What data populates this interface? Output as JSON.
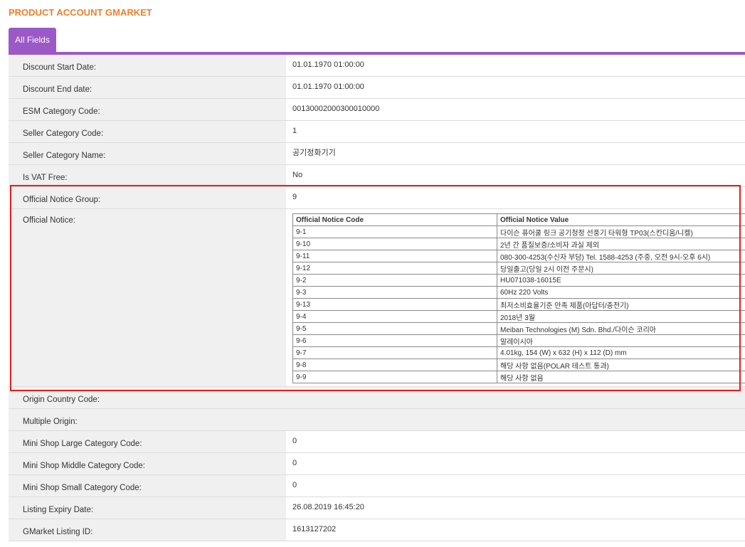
{
  "header": {
    "title": "PRODUCT ACCOUNT GMARKET"
  },
  "tabs": [
    {
      "label": "All Fields"
    }
  ],
  "fields_top": [
    {
      "label": "Discount Start Date:",
      "value": "01.01.1970 01:00:00"
    },
    {
      "label": "Discount End date:",
      "value": "01.01.1970 01:00:00"
    },
    {
      "label": "ESM Category Code:",
      "value": "00130002000300010000"
    },
    {
      "label": "Seller Category Code:",
      "value": "1"
    },
    {
      "label": "Seller Category Name:",
      "value": "공기정화기기"
    },
    {
      "label": "Is VAT Free:",
      "value": "No"
    },
    {
      "label": "Official Notice Group:",
      "value": "9"
    }
  ],
  "official_notice": {
    "label": "Official Notice:",
    "columns": [
      "Official Notice Code",
      "Official Notice Value"
    ],
    "rows": [
      [
        "9-1",
        "다이슨 퓨어쿨 링크 공기청정 선풍기 타워형 TP03(스칸디움/니켈)"
      ],
      [
        "9-10",
        "2년 간 품질보증/소비자 과실 제외"
      ],
      [
        "9-11",
        "080-300-4253(수신자 부담) Tel. 1588-4253 (주중, 오전 9시-오후 6시)"
      ],
      [
        "9-12",
        "당일출고(당일 2시 이전 주문시)"
      ],
      [
        "9-2",
        "HU071038-16015E"
      ],
      [
        "9-3",
        "60Hz 220 Volts"
      ],
      [
        "9-13",
        "최저소비효율기준 만족 제품(아답터/충전기)"
      ],
      [
        "9-4",
        "2018년 3월"
      ],
      [
        "9-5",
        "Meiban Technologies (M) Sdn. Bhd./다이슨 코리아"
      ],
      [
        "9-6",
        "말레이시아"
      ],
      [
        "9-7",
        "4.01kg, 154 (W) x 632 (H) x 112 (D) mm"
      ],
      [
        "9-8",
        "해당 사항 없음(POLAR 테스트 통과)"
      ],
      [
        "9-9",
        "해당 사항 없음"
      ]
    ]
  },
  "fields_bottom": [
    {
      "label": "Origin Country Code:",
      "value": ""
    },
    {
      "label": "Multiple Origin:",
      "value": ""
    },
    {
      "label": "Mini Shop Large Category Code:",
      "value": "0"
    },
    {
      "label": "Mini Shop Middle Category Code:",
      "value": "0"
    },
    {
      "label": "Mini Shop Small Category Code:",
      "value": "0"
    },
    {
      "label": "Listing Expiry Date:",
      "value": "26.08.2019 16:45:20"
    },
    {
      "label": "GMarket Listing ID:",
      "value": "1613127202"
    }
  ],
  "colors": {
    "title": "#f07f2c",
    "accent": "#9b59c8",
    "highlight": "#e02020"
  }
}
